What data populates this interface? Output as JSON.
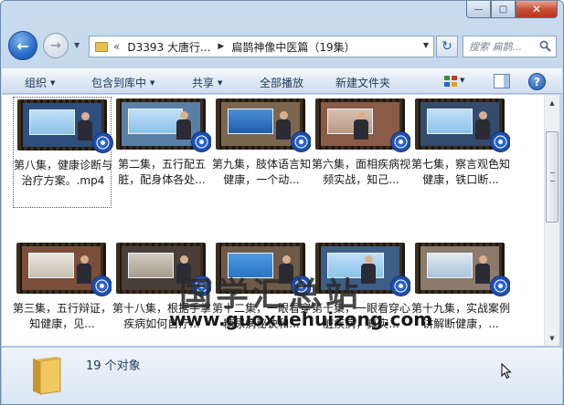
{
  "address": {
    "prefix": "«",
    "segments": [
      "D3393 大唐行...",
      "扁鹊神像中医篇（19集）"
    ]
  },
  "search": {
    "placeholder": "搜索 扁鹊..."
  },
  "commands": {
    "organize": "组织",
    "include": "包含到库中",
    "share": "共享",
    "play_all": "全部播放",
    "new_folder": "新建文件夹"
  },
  "files": [
    {
      "label": "第八集，健康诊断与治疗方案。.mp4",
      "selected": true
    },
    {
      "label": "第二集，五行配五脏，配身体各处..."
    },
    {
      "label": "第九集，肢体语言知健康，一个动..."
    },
    {
      "label": "第六集，面相疾病视频实战，知己..."
    },
    {
      "label": "第七集，察言观色知健康，铁口断..."
    },
    {
      "label": "第三集，五行辩证，知健康，见..."
    },
    {
      "label": "第十八集，根据手掌疾病如何自疗..."
    },
    {
      "label": "第十二集，一眼看穿糖尿病秘诀和..."
    },
    {
      "label": "第十集，一眼看穿心脏疾病，真实..."
    },
    {
      "label": "第十九集，实战案例讲解断健康，..."
    }
  ],
  "watermark": {
    "text": "国学汇总站",
    "url": "www.guoxuehuizong.com"
  },
  "status": {
    "count": "19 个对象"
  },
  "colors": {
    "accent": "#2a62c9",
    "chrome": "#c9dcef"
  }
}
